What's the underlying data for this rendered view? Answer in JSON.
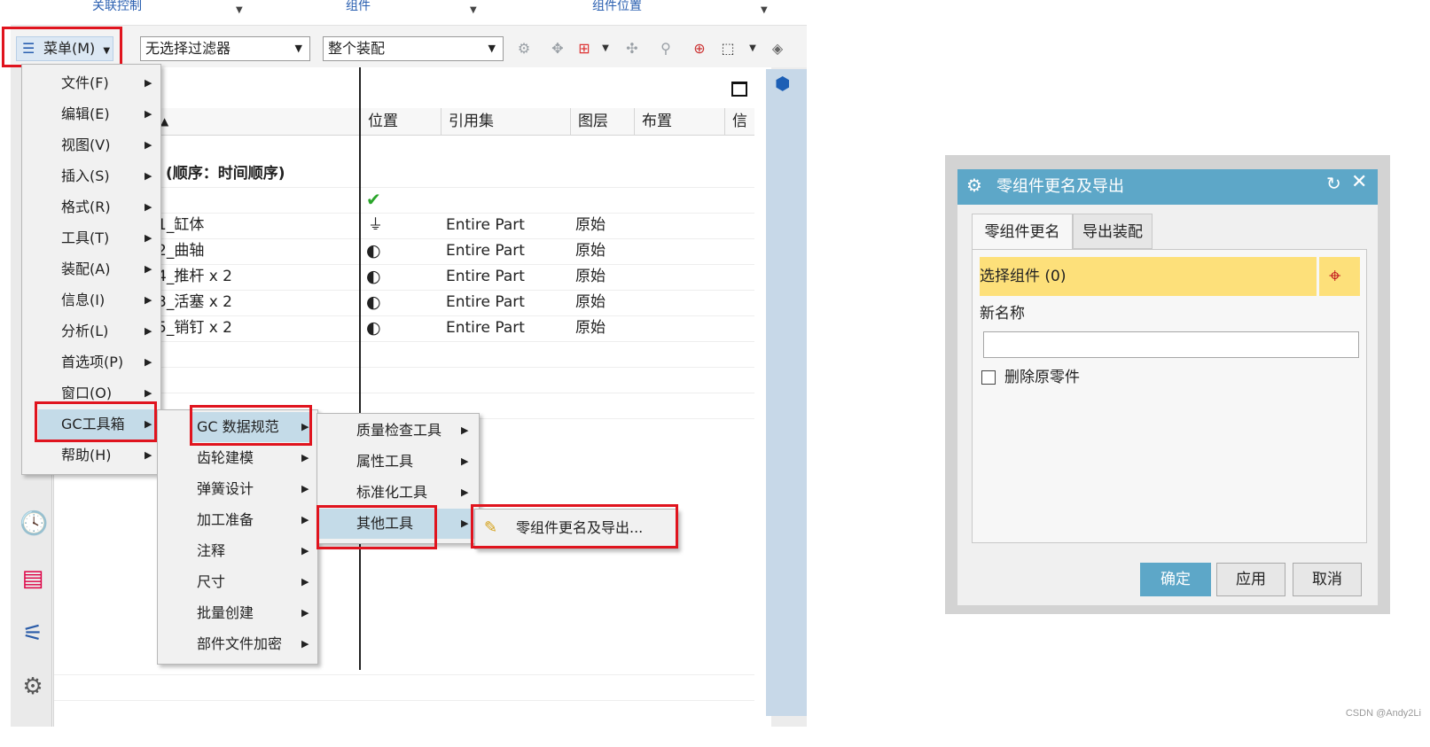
{
  "ribbon": {
    "items": [
      "关联控制",
      "组件",
      "组件位置"
    ]
  },
  "toolbar": {
    "menu_label": "菜单(M)",
    "filter_combo": "无选择过滤器",
    "scope_combo": "整个装配"
  },
  "nav": {
    "columns": [
      "位置",
      "引用集",
      "图层",
      "布置",
      "信息"
    ],
    "group_label": "(顺序：时间顺序)",
    "rows": [
      {
        "name": "1_缸体",
        "ref": "Entire Part",
        "layer": "原始"
      },
      {
        "name": "2_曲轴",
        "ref": "Entire Part",
        "layer": "原始"
      },
      {
        "name": "4_推杆 x 2",
        "ref": "Entire Part",
        "layer": "原始"
      },
      {
        "name": "3_活塞 x 2",
        "ref": "Entire Part",
        "layer": "原始"
      },
      {
        "name": "5_销钉 x 2",
        "ref": "Entire Part",
        "layer": "原始"
      }
    ]
  },
  "main_menu": [
    "文件(F)",
    "编辑(E)",
    "视图(V)",
    "插入(S)",
    "格式(R)",
    "工具(T)",
    "装配(A)",
    "信息(I)",
    "分析(L)",
    "首选项(P)",
    "窗口(O)",
    "GC工具箱",
    "帮助(H)"
  ],
  "gc_menu": [
    "GC 数据规范",
    "齿轮建模",
    "弹簧设计",
    "加工准备",
    "注释",
    "尺寸",
    "批量创建",
    "部件文件加密"
  ],
  "data_menu": [
    "质量检查工具",
    "属性工具",
    "标准化工具",
    "其他工具"
  ],
  "other_menu": [
    "零组件更名及导出..."
  ],
  "dialog": {
    "title": "零组件更名及导出",
    "tabs": [
      "零组件更名",
      "导出装配"
    ],
    "select_label": "选择组件 (0)",
    "new_name_label": "新名称",
    "new_name_value": "",
    "delete_label": "删除原零件",
    "buttons": {
      "ok": "确定",
      "apply": "应用",
      "cancel": "取消"
    }
  },
  "watermark": "CSDN @Andy2Li",
  "colors": {
    "highlight_red": "#e0141e",
    "dialog_title": "#5da7c8",
    "select_bar": "#fde07a",
    "menu_hover": "#c4dbe8"
  }
}
